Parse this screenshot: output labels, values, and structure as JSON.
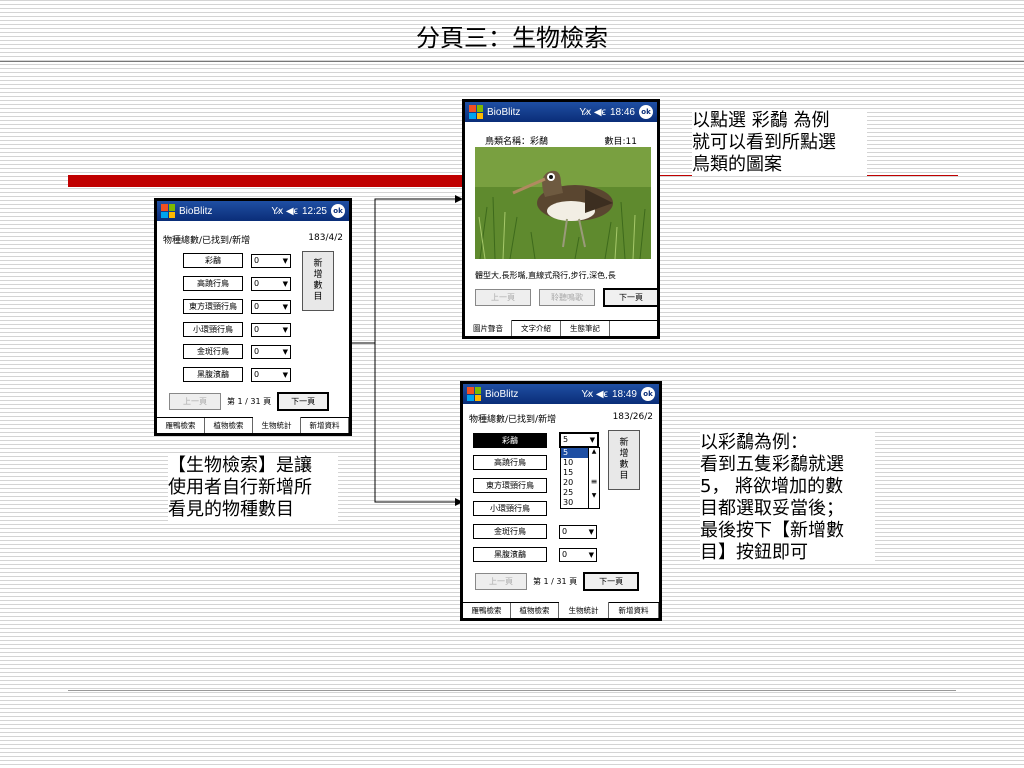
{
  "slide": {
    "title": "分頁三：生物檢索",
    "note_left": "【生物檢索】是讓\n使用者自行新增所\n看見的物種數目",
    "note_top_right": "以點選 彩鷸 為例\n就可以看到所點選\n鳥類的圖案",
    "note_bottom_right": "以彩鷸為例：\n看到五隻彩鷸就選\n5， 將欲增加的數\n目都選取妥當後；\n最後按下【新增數\n目】按鈕即可"
  },
  "screen1": {
    "app_name": "BioBlitz",
    "status_time": "12:25",
    "status_icons": "Y̷x ◀ϵ",
    "ok": "ok",
    "header_label": "物種總數/已找到/新增",
    "header_value": "183/4/2",
    "species": [
      {
        "name": "彩鷸",
        "count": "0"
      },
      {
        "name": "高蹺行鳥",
        "count": "0"
      },
      {
        "name": "東方環頸行鳥",
        "count": "0"
      },
      {
        "name": "小環頸行鳥",
        "count": "0"
      },
      {
        "name": "金斑行鳥",
        "count": "0"
      },
      {
        "name": "黑腹濱鷸",
        "count": "0"
      }
    ],
    "add_button": "新\n增\n數\n目",
    "prev": "上一頁",
    "page_info": "第 1 / 31 頁",
    "next": "下一頁",
    "tabs": [
      "雁鴨檢索",
      "植物檢索",
      "生物統計",
      "新增資料"
    ]
  },
  "screen2": {
    "app_name": "BioBlitz",
    "status_time": "18:46",
    "status_icons": "Y̷x ◀ϵ",
    "ok": "ok",
    "bird_label": "鳥類名稱：彩鷸",
    "count_label": "數目:11",
    "description": "體型大,長形嘴,直線式飛行,步行,深色,長",
    "prev": "上一頁",
    "listen": "聆聽鳴歌",
    "next": "下一頁",
    "tabs": [
      "圖片聲音",
      "文字介紹",
      "生態筆記"
    ]
  },
  "screen3": {
    "app_name": "BioBlitz",
    "status_time": "18:49",
    "status_icons": "Y̷x ◀ϵ",
    "ok": "ok",
    "header_label": "物種總數/已找到/新增",
    "header_value": "183/26/2",
    "species": [
      {
        "name": "彩鷸",
        "count": "5"
      },
      {
        "name": "高蹺行鳥",
        "count": ""
      },
      {
        "name": "東方環頸行鳥",
        "count": ""
      },
      {
        "name": "小環頸行鳥",
        "count": ""
      },
      {
        "name": "金斑行鳥",
        "count": "0"
      },
      {
        "name": "黑腹濱鷸",
        "count": "0"
      }
    ],
    "dropdown_options": [
      "5",
      "10",
      "15",
      "20",
      "25",
      "30"
    ],
    "add_button": "新\n增\n數\n目",
    "prev": "上一頁",
    "page_info": "第 1 / 31 頁",
    "next": "下一頁",
    "tabs": [
      "雁鴨檢索",
      "植物檢索",
      "生物統計",
      "新增資料"
    ]
  },
  "colors": {
    "accent_red": "#c00000",
    "titlebar_blue": "#0a2d78"
  }
}
